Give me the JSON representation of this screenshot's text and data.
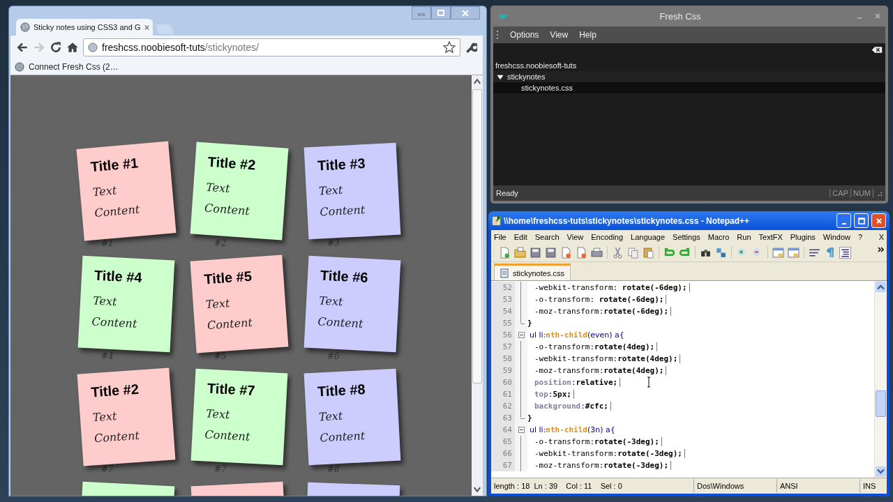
{
  "browser": {
    "tab": {
      "title": "Sticky notes using CSS3 and G",
      "selected": true
    },
    "url": {
      "host": "freshcss.noobiesoft-tuts",
      "path": "/stickynotes/"
    },
    "bookmarks": [
      "Connect Fresh Css (2…"
    ],
    "notes": [
      {
        "title": "Title #1",
        "lines": [
          "Text",
          "Content"
        ],
        "caption": "#1",
        "color": "#ffcccc"
      },
      {
        "title": "Title #2",
        "lines": [
          "Text",
          "Content"
        ],
        "caption": "#2",
        "color": "#ccffcc"
      },
      {
        "title": "Title #3",
        "lines": [
          "Text",
          "Content"
        ],
        "caption": "#3",
        "color": "#ccccff"
      },
      {
        "title": "Title #4",
        "lines": [
          "Text",
          "Content"
        ],
        "caption": "#4",
        "color": "#ccffcc"
      },
      {
        "title": "Title #5",
        "lines": [
          "Text",
          "Content"
        ],
        "caption": "#5",
        "color": "#ffcccc"
      },
      {
        "title": "Title #6",
        "lines": [
          "Text",
          "Content"
        ],
        "caption": "#6",
        "color": "#ccccff"
      },
      {
        "title": "Title #2",
        "lines": [
          "Text",
          "Content"
        ],
        "caption": "#7",
        "color": "#ffcccc"
      },
      {
        "title": "Title #7",
        "lines": [
          "Text",
          "Content"
        ],
        "caption": "#7",
        "color": "#ccffcc"
      },
      {
        "title": "Title #8",
        "lines": [
          "Text",
          "Content"
        ],
        "caption": "#8",
        "color": "#ccccff"
      },
      {
        "color": "#ccffcc"
      },
      {
        "color": "#ffcccc"
      },
      {
        "color": "#ccccff"
      }
    ]
  },
  "fresh_css": {
    "title": "Fresh Css",
    "menu": [
      "Options",
      "View",
      "Help"
    ],
    "tree": {
      "label": "freshcss.noobiesoft-tuts",
      "children": [
        {
          "label": "stickynotes",
          "expanded": true,
          "selected": false,
          "children": [
            {
              "label": "stickynotes.css",
              "selected": true
            }
          ]
        }
      ]
    },
    "status": "Ready",
    "indicators": [
      "CAP",
      "NUM"
    ]
  },
  "notepad": {
    "title": "\\\\home\\freshcss-tuts\\stickynotes\\stickynotes.css - Notepad++",
    "menu": [
      "File",
      "Edit",
      "Search",
      "View",
      "Encoding",
      "Language",
      "Settings",
      "Macro",
      "Run",
      "TextFX",
      "Plugins",
      "Window",
      "?"
    ],
    "menu_close": "X",
    "tabs": [
      {
        "label": "stickynotes.css",
        "selected": true
      }
    ],
    "lines": [
      {
        "number": "52",
        "kind": "inner",
        "tokens": [
          {
            "kind": "prop",
            "t": "-webkit-transform: "
          },
          {
            "kind": "value",
            "t": "rotate(-6deg);"
          }
        ]
      },
      {
        "number": "53",
        "kind": "inner",
        "tokens": [
          {
            "kind": "prop",
            "t": "-o-transform: "
          },
          {
            "kind": "value",
            "t": "rotate(-6deg);"
          }
        ]
      },
      {
        "number": "54",
        "kind": "inner",
        "tokens": [
          {
            "kind": "prop",
            "t": "-moz-transform:"
          },
          {
            "kind": "value",
            "t": "rotate(-6deg);"
          }
        ]
      },
      {
        "number": "55",
        "kind": "end",
        "tokens": [
          {
            "kind": "value",
            "t": "}"
          }
        ]
      },
      {
        "number": "56",
        "kind": "open",
        "tokens": [
          {
            "kind": "selector",
            "t": "ul li:"
          },
          {
            "kind": "pseudo",
            "t": "nth-child"
          },
          {
            "kind": "selector",
            "t": "(even) a{"
          }
        ]
      },
      {
        "number": "57",
        "kind": "inner",
        "tokens": [
          {
            "kind": "prop",
            "t": "-o-transform:"
          },
          {
            "kind": "value",
            "t": "rotate(4deg);"
          }
        ]
      },
      {
        "number": "58",
        "kind": "inner",
        "tokens": [
          {
            "kind": "prop",
            "t": "-webkit-transform:"
          },
          {
            "kind": "value",
            "t": "rotate(4deg);"
          }
        ]
      },
      {
        "number": "59",
        "kind": "inner",
        "tokens": [
          {
            "kind": "prop",
            "t": "-moz-transform:"
          },
          {
            "kind": "value",
            "t": "rotate(4deg);"
          }
        ]
      },
      {
        "number": "60",
        "kind": "inner",
        "tokens": [
          {
            "kind": "keyword",
            "t": "position"
          },
          {
            "kind": "prop",
            "t": ":"
          },
          {
            "kind": "value",
            "t": "relative;"
          }
        ]
      },
      {
        "number": "61",
        "kind": "inner",
        "tokens": [
          {
            "kind": "keyword",
            "t": "top"
          },
          {
            "kind": "prop",
            "t": ":"
          },
          {
            "kind": "value",
            "t": "5px;"
          }
        ]
      },
      {
        "number": "62",
        "kind": "inner",
        "tokens": [
          {
            "kind": "keyword",
            "t": "background"
          },
          {
            "kind": "prop",
            "t": ":"
          },
          {
            "kind": "value",
            "t": "#cfc;"
          }
        ]
      },
      {
        "number": "63",
        "kind": "end",
        "tokens": [
          {
            "kind": "value",
            "t": "}"
          }
        ]
      },
      {
        "number": "64",
        "kind": "open",
        "tokens": [
          {
            "kind": "selector",
            "t": "ul li:"
          },
          {
            "kind": "pseudo",
            "t": "nth-child"
          },
          {
            "kind": "selector",
            "t": "(3n) a{"
          }
        ]
      },
      {
        "number": "65",
        "kind": "inner",
        "tokens": [
          {
            "kind": "prop",
            "t": "-o-transform:"
          },
          {
            "kind": "value",
            "t": "rotate(-3deg);"
          }
        ]
      },
      {
        "number": "66",
        "kind": "inner",
        "tokens": [
          {
            "kind": "prop",
            "t": "-webkit-transform:"
          },
          {
            "kind": "value",
            "t": "rotate(-3deg);"
          }
        ]
      },
      {
        "number": "67",
        "kind": "inner",
        "tokens": [
          {
            "kind": "prop",
            "t": "-moz-transform:"
          },
          {
            "kind": "value",
            "t": "rotate(-3deg);"
          }
        ]
      }
    ],
    "status": [
      "length : 18  Ln : 39    Col : 11    Sel : 0",
      "Dos\\Windows",
      "ANSI",
      "INS"
    ]
  }
}
